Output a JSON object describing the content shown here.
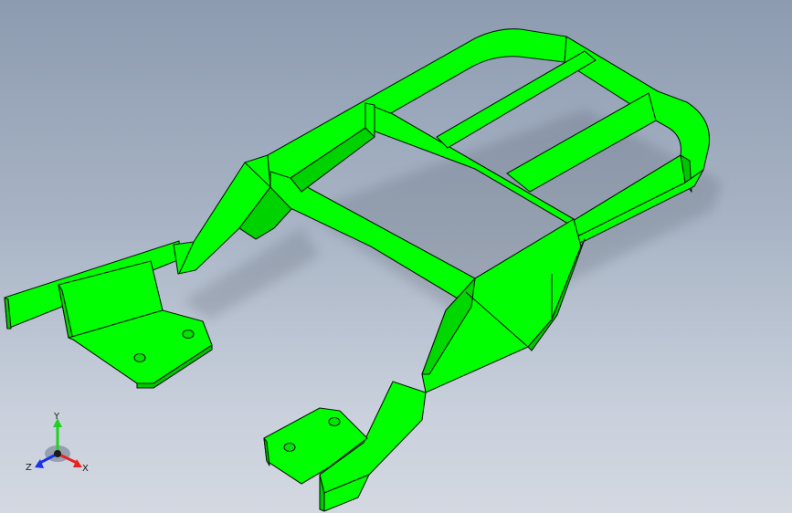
{
  "viewport": {
    "colors": {
      "part": "#00ff00",
      "part_shadow": "#00c800",
      "edge": "#0a1a0a",
      "x_axis": "#e8221c",
      "y_axis": "#1fd21f",
      "z_axis": "#1c32e8"
    }
  },
  "triad": {
    "x_label": "X",
    "y_label": "Y",
    "z_label": "Z"
  }
}
